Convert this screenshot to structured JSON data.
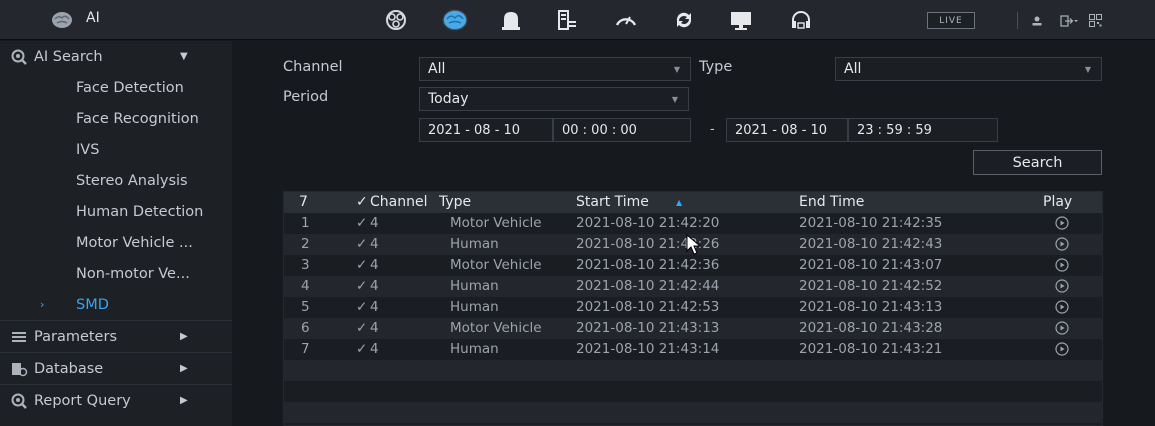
{
  "app": {
    "title": "AI"
  },
  "topbar": {
    "icons": [
      "camera-icon",
      "ai-brain-icon",
      "alarm-bell-icon",
      "storage-icon",
      "performance-gauge-icon",
      "sync-icon",
      "display-icon",
      "support-headset-icon"
    ],
    "live_label": "LIVE",
    "accent": "#35a6f2"
  },
  "sidebar": {
    "sections": [
      {
        "label": "AI Search",
        "icon": "ai-search-icon",
        "expanded": true
      },
      {
        "label": "Parameters",
        "icon": "parameters-icon"
      },
      {
        "label": "Database",
        "icon": "database-icon"
      },
      {
        "label": "Report Query",
        "icon": "report-query-icon"
      }
    ],
    "subitems": [
      {
        "label": "Face Detection"
      },
      {
        "label": "Face Recognition"
      },
      {
        "label": "IVS"
      },
      {
        "label": "Stereo Analysis"
      },
      {
        "label": "Human Detection"
      },
      {
        "label": "Motor Vehicle ..."
      },
      {
        "label": "Non-motor Ve..."
      },
      {
        "label": "SMD",
        "active": true
      }
    ]
  },
  "filters": {
    "channel_label": "Channel",
    "channel_value": "All",
    "type_label": "Type",
    "type_value": "All",
    "period_label": "Period",
    "period_value": "Today",
    "start_date": "2021 - 08 - 10",
    "start_time": "00 : 00 : 00",
    "end_date": "2021 - 08 - 10",
    "end_time": "23 : 59 : 59",
    "range_separator": "-",
    "search_label": "Search"
  },
  "table": {
    "headers": {
      "count": "7",
      "channel": "Channel",
      "type": "Type",
      "start": "Start Time",
      "end": "End Time",
      "play": "Play"
    },
    "rows": [
      {
        "no": "1",
        "channel": "4",
        "type": "Motor Vehicle",
        "start": "2021-08-10 21:42:20",
        "end": "2021-08-10 21:42:35"
      },
      {
        "no": "2",
        "channel": "4",
        "type": "Human",
        "start": "2021-08-10 21:42:26",
        "end": "2021-08-10 21:42:43"
      },
      {
        "no": "3",
        "channel": "4",
        "type": "Motor Vehicle",
        "start": "2021-08-10 21:42:36",
        "end": "2021-08-10 21:43:07"
      },
      {
        "no": "4",
        "channel": "4",
        "type": "Human",
        "start": "2021-08-10 21:42:44",
        "end": "2021-08-10 21:42:52"
      },
      {
        "no": "5",
        "channel": "4",
        "type": "Human",
        "start": "2021-08-10 21:42:53",
        "end": "2021-08-10 21:43:13"
      },
      {
        "no": "6",
        "channel": "4",
        "type": "Motor Vehicle",
        "start": "2021-08-10 21:43:13",
        "end": "2021-08-10 21:43:28"
      },
      {
        "no": "7",
        "channel": "4",
        "type": "Human",
        "start": "2021-08-10 21:43:14",
        "end": "2021-08-10 21:43:21"
      }
    ]
  }
}
